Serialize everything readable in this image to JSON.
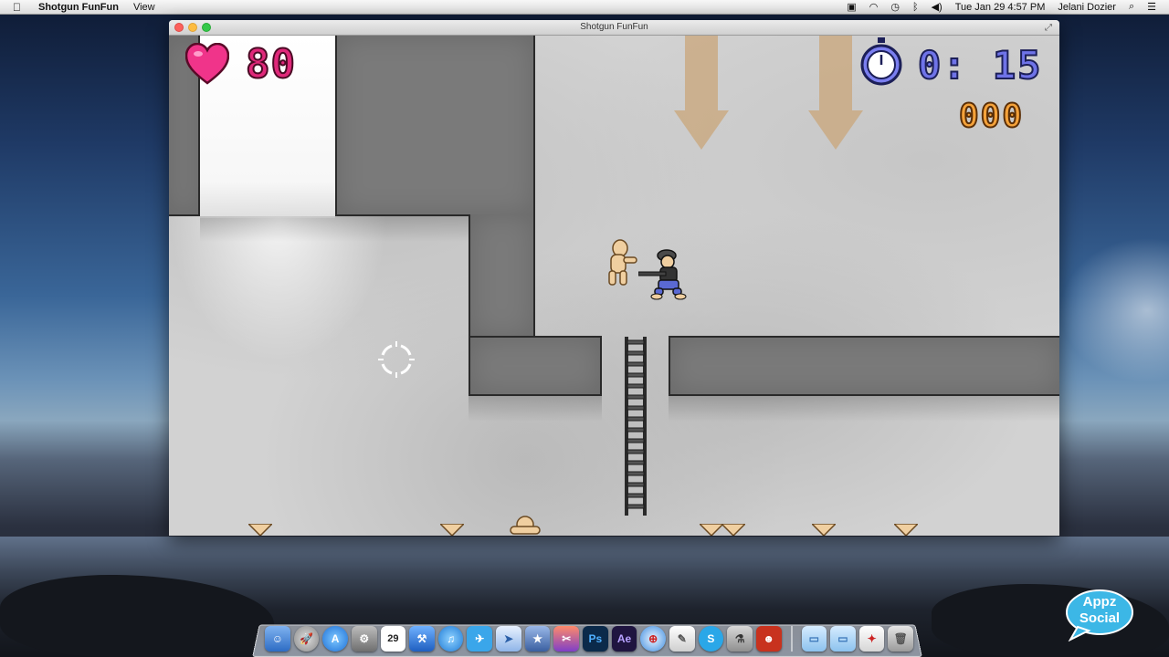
{
  "menubar": {
    "app_name": "Shotgun FunFun",
    "menus": [
      "View"
    ],
    "clock": "Tue Jan 29  4:57 PM",
    "user": "Jelani Dozier"
  },
  "window": {
    "title": "Shotgun FunFun"
  },
  "hud": {
    "health": "80",
    "timer": "0: 15",
    "score": "000"
  },
  "colors": {
    "health": "#e0287a",
    "timer": "#6f73e8",
    "score": "#f5a23a"
  },
  "dock": {
    "icons": [
      "finder-icon",
      "launchpad-icon",
      "app-store-icon",
      "system-preferences-icon",
      "calendar-icon",
      "xcode-icon",
      "itunes-icon",
      "twitter-icon",
      "preview-icon",
      "imovie-icon",
      "final-cut-icon",
      "photoshop-icon",
      "after-effects-icon",
      "safari-icon",
      "script-editor-icon",
      "skype-icon",
      "xcode-tools-icon",
      "game-app-icon",
      "folder-icon",
      "documents-icon",
      "downloads-icon",
      "trash-icon"
    ],
    "calendar_day": "29",
    "photoshop_label": "Ps",
    "after_effects_label": "Ae"
  },
  "overlay": {
    "badge_line1": "Appz",
    "badge_line2": "Social"
  }
}
